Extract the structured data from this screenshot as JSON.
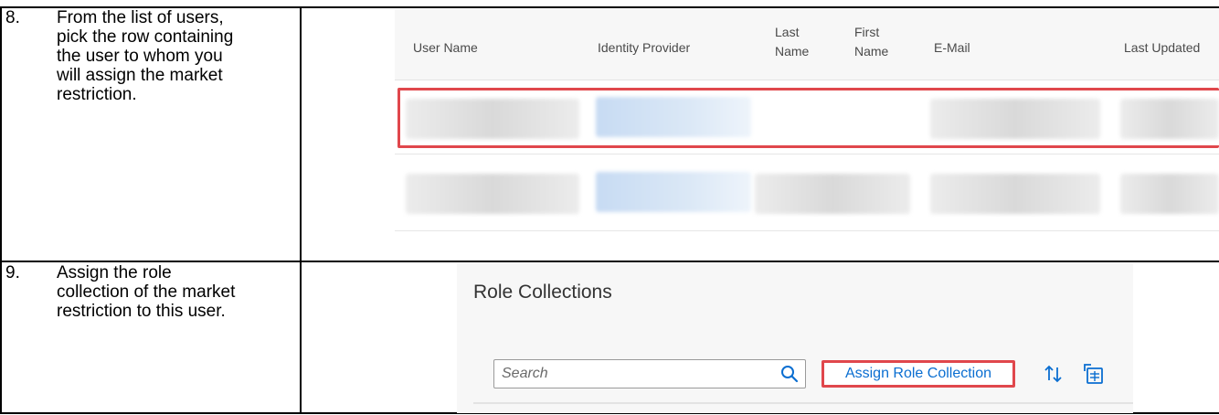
{
  "steps": [
    {
      "number": "8.",
      "lines": [
        "From the list of users,",
        "pick the row containing",
        "the user to whom you",
        "will assign the market",
        "restriction."
      ]
    },
    {
      "number": "9.",
      "lines": [
        "Assign the role",
        "collection of the market",
        "restriction to this user."
      ]
    }
  ],
  "user_list": {
    "columns": [
      {
        "lines": [
          "User Name"
        ]
      },
      {
        "lines": [
          "Identity Provider"
        ]
      },
      {
        "lines": [
          "Last",
          "Name"
        ]
      },
      {
        "lines": [
          "First",
          "Name"
        ]
      },
      {
        "lines": [
          "E-Mail"
        ]
      },
      {
        "lines": [
          "Last Updated"
        ]
      }
    ],
    "highlight_color": "#e0474c"
  },
  "role_collections": {
    "title": "Role Collections",
    "search_placeholder": "Search",
    "search_value": "",
    "assign_button_label": "Assign Role Collection",
    "link_color": "#0a6ed1"
  },
  "icons": [
    "search-icon",
    "sort-icon",
    "export-icon"
  ]
}
